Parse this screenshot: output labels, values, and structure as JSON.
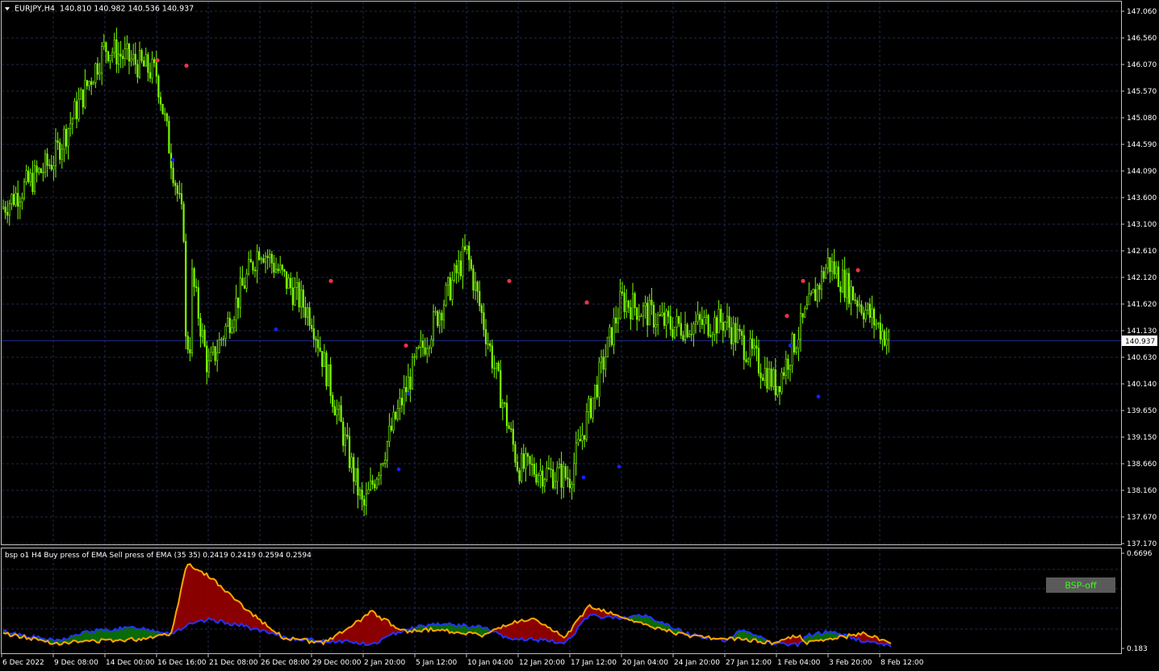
{
  "colors": {
    "background": "#000000",
    "grid": "#1f2a52",
    "frame": "#c0c0c0",
    "candle": "#7cfc00",
    "bid_line": "#1a2a8a",
    "price_box_bg": "#ffffff",
    "sell_dot": "#e8334a",
    "buy_dot": "#1420ff",
    "buy_fill": "#0a6b0a",
    "sell_fill": "#8b0000",
    "buy_line": "#2233ff",
    "sell_line": "#ffa500",
    "bsp_button_bg": "#5a5a5a",
    "bsp_button_text": "#39ff14",
    "text": "#ffffff"
  },
  "header": {
    "symbol_text": "EURJPY,H4",
    "ohlc_text": "140.810 140.982 140.536 140.937",
    "menu_icon": "triangle-down-icon"
  },
  "price_axis": {
    "labels": [
      "147.060",
      "146.560",
      "146.070",
      "145.570",
      "145.080",
      "144.590",
      "144.090",
      "143.600",
      "143.100",
      "142.610",
      "142.120",
      "141.620",
      "141.130",
      "140.630",
      "140.140",
      "139.650",
      "139.150",
      "138.660",
      "138.160",
      "137.670",
      "137.170"
    ],
    "current_price": "140.937"
  },
  "indicator": {
    "label": "bsp o1 H4 Buy press of EMA Sell press of EMA (35 35) 0.2419 0.2419 0.2594 0.2594",
    "axis_top": "0.6696",
    "axis_bottom": "0.183",
    "button_label": "BSP-off"
  },
  "time_axis": {
    "labels": [
      "6 Dec 2022",
      "9 Dec 08:00",
      "14 Dec 00:00",
      "16 Dec 16:00",
      "21 Dec 08:00",
      "26 Dec 08:00",
      "29 Dec 00:00",
      "2 Jan 20:00",
      "5 Jan 12:00",
      "10 Jan 04:00",
      "12 Jan 20:00",
      "17 Jan 12:00",
      "20 Jan 04:00",
      "24 Jan 20:00",
      "27 Jan 12:00",
      "1 Feb 04:00",
      "3 Feb 20:00",
      "8 Feb 12:00"
    ]
  },
  "chart_data": {
    "type": "line",
    "title": "EURJPY,H4",
    "ylim": [
      137.17,
      147.06
    ],
    "close_path": [
      [
        "6 Dec 2022",
        143.4
      ],
      [
        "9 Dec 08:00",
        144.3
      ],
      [
        "14 Dec 00:00",
        146.4
      ],
      [
        "16 Dec 16:00",
        145.9
      ],
      [
        "21 Dec 08:00",
        140.4
      ],
      [
        "26 Dec 08:00",
        142.7
      ],
      [
        "29 Dec 00:00",
        141.4
      ],
      [
        "2 Jan 20:00",
        137.8
      ],
      [
        "5 Jan 12:00",
        140.5
      ],
      [
        "10 Jan 04:00",
        142.6
      ],
      [
        "12 Jan 20:00",
        138.6
      ],
      [
        "17 Jan 12:00",
        138.4
      ],
      [
        "20 Jan 04:00",
        141.7
      ],
      [
        "24 Jan 20:00",
        141.2
      ],
      [
        "27 Jan 12:00",
        141.3
      ],
      [
        "1 Feb 04:00",
        140.1
      ],
      [
        "3 Feb 20:00",
        142.4
      ],
      [
        "8 Feb 12:00",
        140.9
      ]
    ],
    "sell_signals": [
      146.15,
      146.05,
      142.05,
      140.85,
      142.05,
      141.65,
      141.4,
      142.05,
      142.25
    ],
    "buy_signals": [
      144.3,
      141.15,
      139.95,
      138.55,
      138.4,
      138.6,
      140.85,
      139.9
    ],
    "indicator_series": [
      {
        "name": "Buy press of EMA",
        "last": 0.2419
      },
      {
        "name": "Sell press of EMA",
        "last": 0.2594
      }
    ],
    "indicator_ylim": [
      0.183,
      0.6696
    ]
  }
}
